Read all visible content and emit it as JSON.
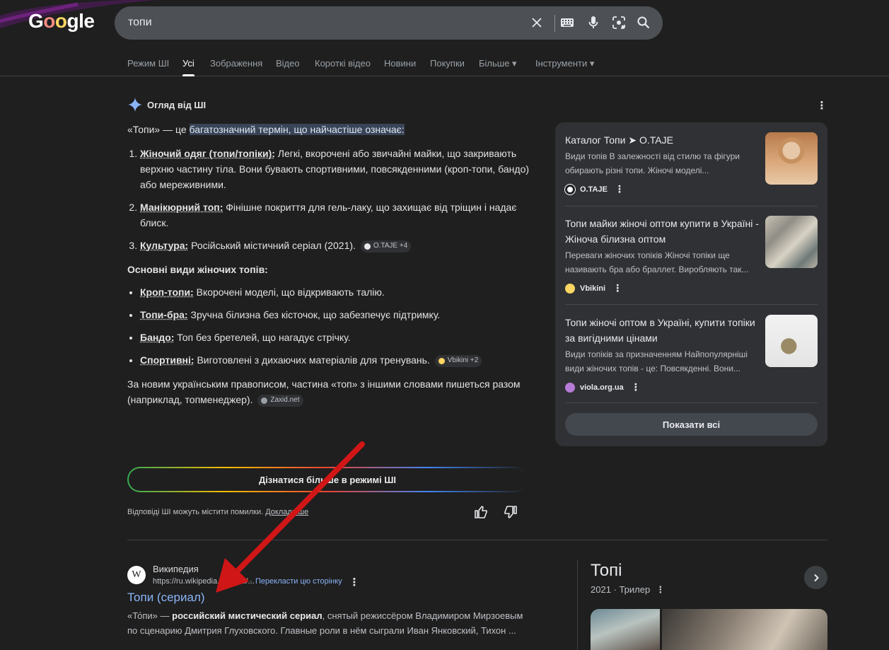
{
  "header": {
    "logo_text_pre": "G",
    "logo_o1": "o",
    "logo_o2": "o",
    "logo_text_post": "gle",
    "search_value": "топи",
    "icons": [
      "clear-icon",
      "keyboard-icon",
      "mic-icon",
      "lens-icon",
      "search-icon"
    ]
  },
  "tabs": [
    {
      "label": "Режим ШІ",
      "active": false
    },
    {
      "label": "Усі",
      "active": true
    },
    {
      "label": "Зображення",
      "active": false
    },
    {
      "label": "Відео",
      "active": false
    },
    {
      "label": "Короткі відео",
      "active": false
    },
    {
      "label": "Новини",
      "active": false
    },
    {
      "label": "Покупки",
      "active": false
    },
    {
      "label": "Більше ▾",
      "active": false
    },
    {
      "label": "Інструменти ▾",
      "active": false
    }
  ],
  "ai_overview": {
    "title": "Огляд від ШІ",
    "intro_pre": "«Топи» — це ",
    "intro_highlight": "багатозначний термін, що найчастіше означає:",
    "meanings": [
      {
        "term": "Жіночий одяг (топи/топіки):",
        "text": " Легкі, вкорочені або звичайні майки, що закривають верхню частину тіла. Вони бувають спортивними, повсякденними (кроп-топи, бандо) або мереживними."
      },
      {
        "term": "Манікюрний топ:",
        "text": " Фінішне покриття для гель-лаку, що захищає від тріщин і надає блиск."
      },
      {
        "term": "Культура:",
        "text": " Російський містичний серіал (2021).",
        "chip": "O.TAJE +4"
      }
    ],
    "types_heading": "Основні види жіночих топів:",
    "types": [
      {
        "term": "Кроп-топи:",
        "text": " Вкорочені моделі, що відкривають талію."
      },
      {
        "term": "Топи-бра:",
        "text": " Зручна білизна без кісточок, що забезпечує підтримку."
      },
      {
        "term": "Бандо:",
        "text": " Топ без бретелей, що нагадує стрічку."
      },
      {
        "term": "Спортивні:",
        "text": " Виготовлені з дихаючих матеріалів для тренувань.",
        "chip": "Vbikini +2"
      }
    ],
    "note": "За новим українським правописом, частина «топ» з іншими словами пишеться разом (наприклад, топменеджер).",
    "note_chip": "Zaxid.net",
    "more_button": "Дізнатися більше в режимі ШІ",
    "disclaimer": "Відповіді ШІ можуть містити помилки. ",
    "disclaimer_link": "Докладніше"
  },
  "sources": [
    {
      "title": "Каталог Топи ➤ O.TAJE",
      "snippet": "Види топів В залежності від стилю та фігури обирають різні топи. Жіночі моделі...",
      "site": "O.TAJE"
    },
    {
      "title": "Топи майки жіночі оптом купити в Україні - Жіноча білизна оптом",
      "snippet": "Переваги жіночих топіків Жіночі топіки ще називають бра або браллет. Виробляють так...",
      "site": "Vbikini"
    },
    {
      "title": "Топи жіночі оптом в Україні, купити топіки за вигідними цінами",
      "snippet": "Види топіків за призначенням Найпопулярніші види жіночих топів - це: Повсякденні. Вони...",
      "site": "viola.org.ua"
    }
  ],
  "show_all": "Показати всі",
  "result": {
    "favicon": "W",
    "site": "Википедия",
    "url": "https://ru.wikipedia.org/wiki/...",
    "translate": "Перекласти цю сторінку",
    "title": "Топи (сериал)",
    "snippet_pre": "«То́пи» — ",
    "snippet_bold": "российский мистический сериал",
    "snippet_post": ", снятый режиссёром Владимиром Мирзоевым по сценарию Дмитрия Глуховского. Главные роли в нём сыграли Иван Янковский, Тихон ..."
  },
  "knowledge_panel": {
    "title": "Топі",
    "subtitle": "2021 · Трилер"
  },
  "colors": {
    "background": "#1f1f1f",
    "link": "#8ab4f8",
    "highlight": "#394457",
    "arrow": "#d01616"
  }
}
